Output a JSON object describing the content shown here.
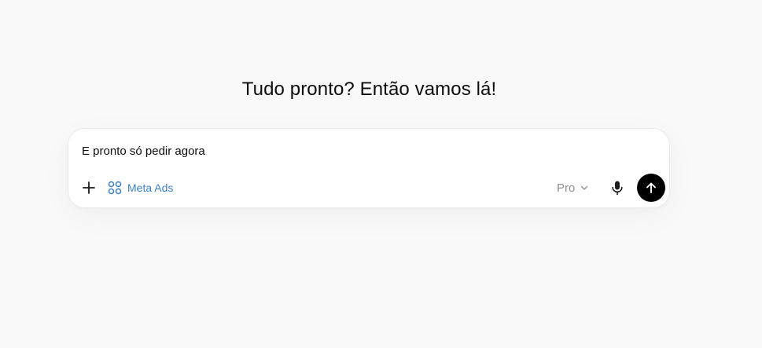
{
  "heading": "Tudo pronto? Então vamos lá!",
  "composer": {
    "input_value": "E pronto só pedir agora",
    "add_icon": "plus-icon",
    "tool": {
      "icon": "grid-icon",
      "label": "Meta Ads",
      "color": "#3b82c4"
    },
    "model": {
      "label": "Pro",
      "icon": "chevron-down-icon"
    },
    "mic_icon": "microphone-icon",
    "send_icon": "arrow-up-icon"
  }
}
